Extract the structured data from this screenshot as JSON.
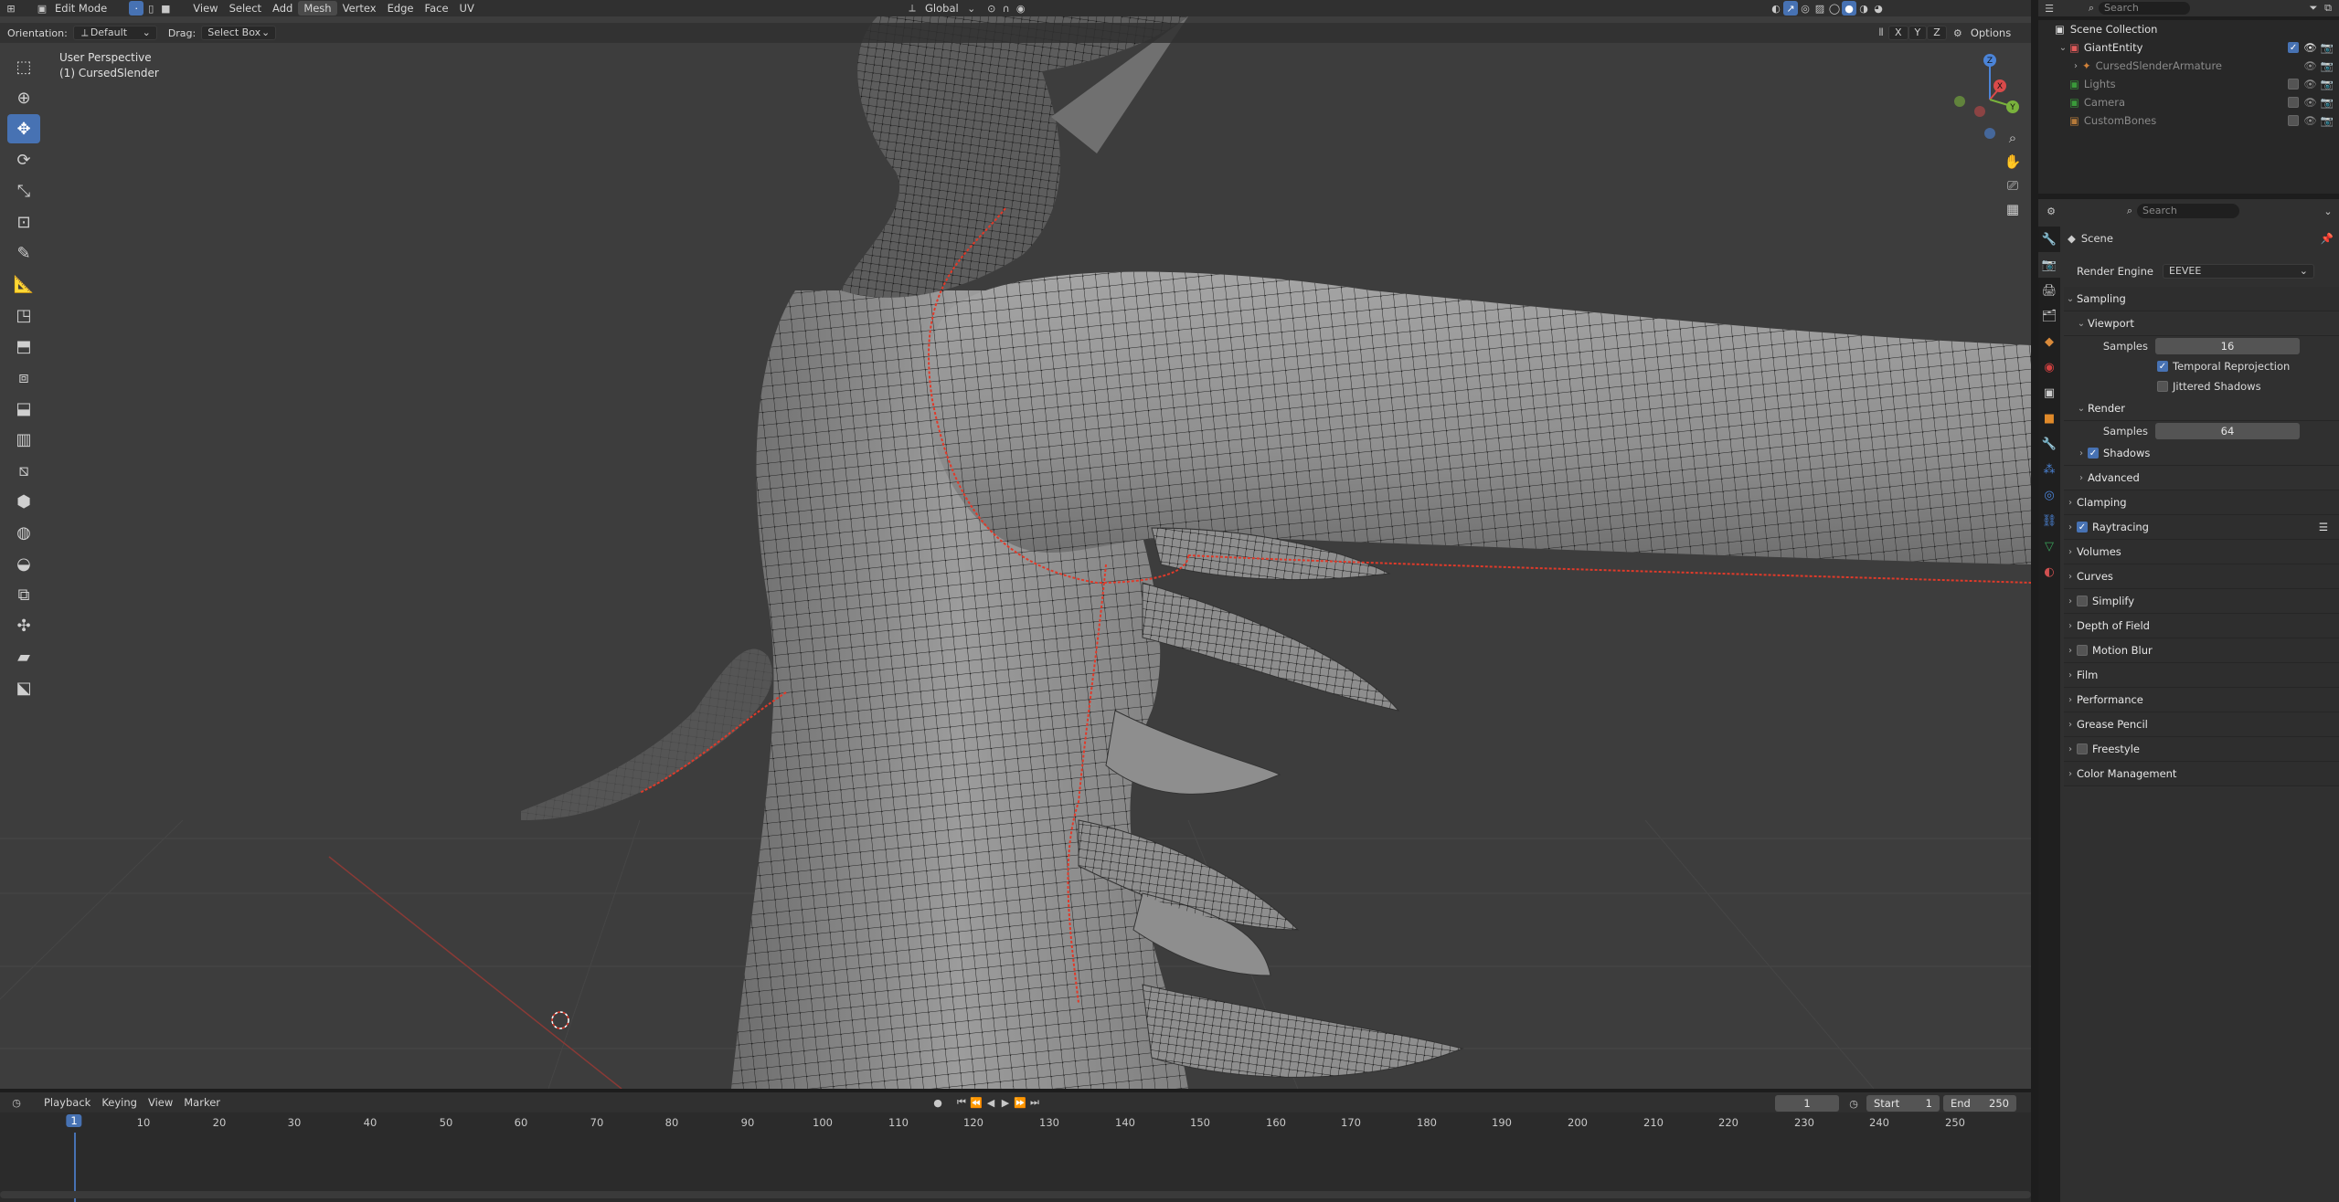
{
  "header": {
    "mode": "Edit Mode",
    "menus": [
      "View",
      "Select",
      "Add",
      "Mesh",
      "Vertex",
      "Edge",
      "Face",
      "UV"
    ],
    "active_menu": "Mesh",
    "transform_orientation": "Global",
    "search_placeholder": "Search"
  },
  "tool_header": {
    "orientation_label": "Orientation:",
    "orientation_value": "Default",
    "drag_label": "Drag:",
    "drag_value": "Select Box",
    "axes": [
      "X",
      "Y",
      "Z"
    ],
    "options_label": "Options"
  },
  "viewport": {
    "view_name": "User Perspective",
    "object_name": "(1) CursedSlender"
  },
  "outliner": {
    "title": "Scene Collection",
    "items": [
      {
        "label": "GiantEntity",
        "level": 1
      },
      {
        "label": "CursedSlenderArmature",
        "level": 2
      },
      {
        "label": "Lights",
        "level": 1
      },
      {
        "label": "Camera",
        "level": 1
      },
      {
        "label": "CustomBones",
        "level": 1
      }
    ]
  },
  "properties": {
    "search_placeholder": "Search",
    "context": "Scene",
    "render_engine_label": "Render Engine",
    "render_engine_value": "EEVEE",
    "sampling": "Sampling",
    "viewport": "Viewport",
    "samples_label": "Samples",
    "viewport_samples": "16",
    "temporal_reprojection": "Temporal Reprojection",
    "jittered_shadows": "Jittered Shadows",
    "render": "Render",
    "render_samples": "64",
    "shadows": "Shadows",
    "advanced": "Advanced",
    "panels": [
      "Clamping",
      "Raytracing",
      "Volumes",
      "Curves",
      "Simplify",
      "Depth of Field",
      "Motion Blur",
      "Film",
      "Performance",
      "Grease Pencil",
      "Freestyle",
      "Color Management"
    ]
  },
  "timeline": {
    "menus": [
      "Playback",
      "Keying",
      "View",
      "Marker"
    ],
    "current_frame": "1",
    "start_label": "Start",
    "start_value": "1",
    "end_label": "End",
    "end_value": "250",
    "ticks": [
      "1",
      "10",
      "20",
      "30",
      "40",
      "50",
      "60",
      "70",
      "80",
      "90",
      "100",
      "110",
      "120",
      "130",
      "140",
      "150",
      "160",
      "170",
      "180",
      "190",
      "200",
      "210",
      "220",
      "230",
      "240",
      "250"
    ]
  },
  "colors": {
    "accent": "#4772b3",
    "seam": "#e03a2a",
    "viewport_bg": "#3d3d3d",
    "mesh": "#9a9a9a"
  }
}
